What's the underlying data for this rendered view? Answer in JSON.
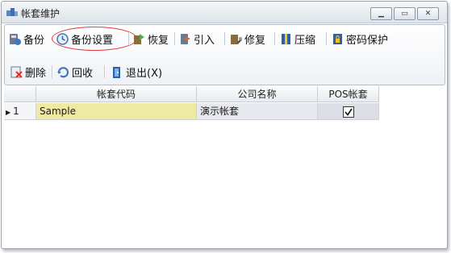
{
  "window": {
    "title": "帐套维护"
  },
  "toolbar": {
    "row1": [
      {
        "id": "backup",
        "label": "备份",
        "icon": "backup-icon"
      },
      {
        "id": "backup-settings",
        "label": "备份设置",
        "icon": "backup-settings-icon",
        "highlighted": true
      },
      {
        "id": "restore",
        "label": "恢复",
        "icon": "restore-icon"
      },
      {
        "id": "import",
        "label": "引入",
        "icon": "import-icon"
      },
      {
        "id": "repair",
        "label": "修复",
        "icon": "repair-icon"
      },
      {
        "id": "compress",
        "label": "压缩",
        "icon": "compress-icon"
      },
      {
        "id": "password-protect",
        "label": "密码保护",
        "icon": "password-protect-icon"
      }
    ],
    "row2": [
      {
        "id": "delete",
        "label": "删除",
        "icon": "delete-icon"
      },
      {
        "id": "recycle",
        "label": "回收",
        "icon": "recycle-icon"
      },
      {
        "id": "exit",
        "label": "退出(X)",
        "icon": "exit-icon"
      }
    ]
  },
  "grid": {
    "columns": [
      "帐套代码",
      "公司名称",
      "POS帐套"
    ],
    "rows": [
      {
        "index": "1",
        "code": "Sample",
        "company": "演示帐套",
        "pos": true
      }
    ]
  },
  "colors": {
    "highlight_circle": "#e03a3a",
    "selected_cell": "#eeeaa3",
    "row_cell": "#e7e9ee"
  }
}
